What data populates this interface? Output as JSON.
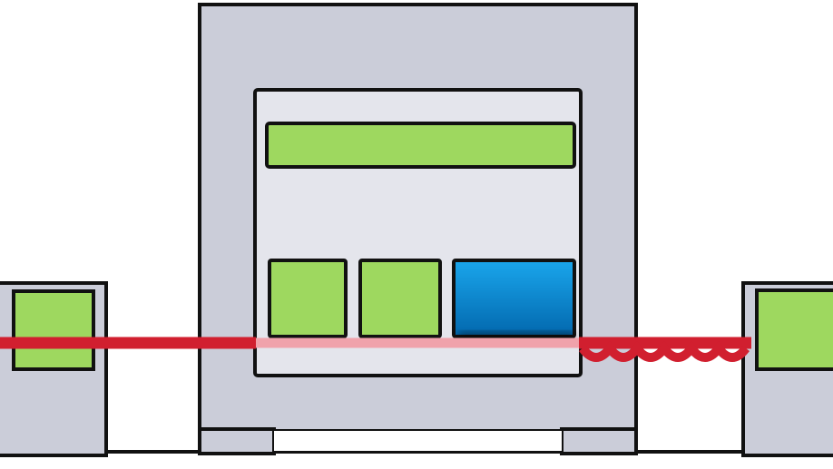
{
  "colors": {
    "housing_fill": "#cbcdd9",
    "panel_fill": "#e4e5ec",
    "module_green": "#9ed85f",
    "module_blue_top": "#1aa6ec",
    "module_blue_bottom": "#0267ad",
    "beam_red": "#d11f2f",
    "beam_faded": "#f0a2ab",
    "outline": "#111111",
    "background": "#ffffff"
  },
  "icons": {
    "left_unit": "left-small-unit-icon",
    "right_unit": "right-small-unit-icon",
    "central_unit": "central-housing-icon",
    "beam": "red-beam-line",
    "coil": "coiled-cable-icon"
  }
}
